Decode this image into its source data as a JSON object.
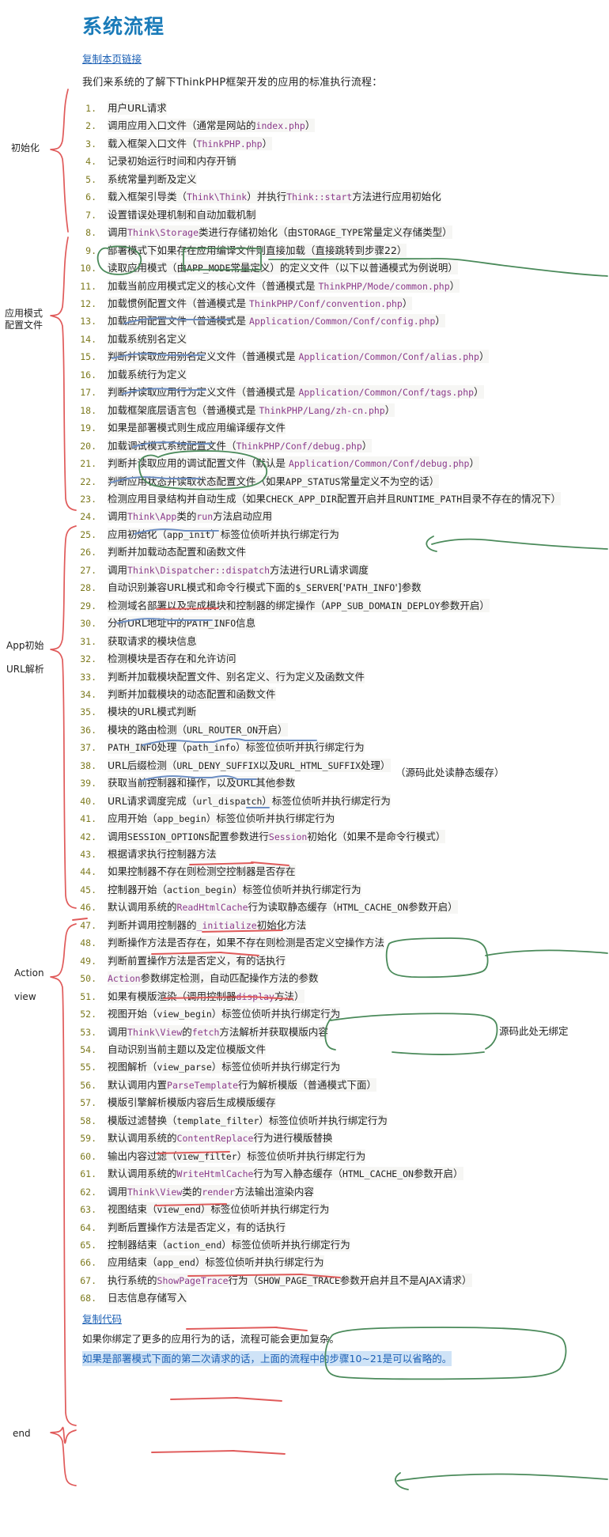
{
  "page": {
    "title": "系统流程",
    "copy_link_label": "复制本页链接",
    "intro": "我们来系统的了解下ThinkPHP框架开发的应用的标准执行流程：",
    "copy_code_label": "复制代码",
    "note": "如果你绑定了更多的应用行为的话，流程可能会更加复杂。",
    "note_highlight": "如果是部署模式下面的第二次请求的话，上面的流程中的步骤10~21是可以省略的。",
    "title_color": "#1a7bb9",
    "link_color": "#1a5fb4",
    "number_color": "#7d7a1e",
    "code_color": "#8b3a8b",
    "red_annotation_color": "#e05a5a",
    "green_annotation_color": "#4a8a5a",
    "blue_underline_color": "#6d8fc4"
  },
  "group_labels": [
    {
      "name": "init",
      "text": "初始化"
    },
    {
      "name": "app-mode-config",
      "text": "应用模式\n配置文件"
    },
    {
      "name": "app-init-url-parse",
      "text": "App初始\n\nURL解析"
    },
    {
      "name": "action-view",
      "text": "Action\n\nview"
    },
    {
      "name": "end",
      "text": "end"
    }
  ],
  "annotations": [
    {
      "name": "note-read-static-cache",
      "text": "（源码此处读静态缓存）"
    },
    {
      "name": "note-no-binding",
      "text": "源码此处无绑定"
    }
  ],
  "steps": [
    {
      "n": 1,
      "text": "用户URL请求"
    },
    {
      "n": 2,
      "text": "调用应用入口文件（通常是网站的index.php）"
    },
    {
      "n": 3,
      "text": "载入框架入口文件（ThinkPHP.php）"
    },
    {
      "n": 4,
      "text": "记录初始运行时间和内存开销"
    },
    {
      "n": 5,
      "text": "系统常量判断及定义"
    },
    {
      "n": 6,
      "text": "载入框架引导类（Think\\Think）并执行Think::start方法进行应用初始化"
    },
    {
      "n": 7,
      "text": "设置错误处理机制和自动加载机制"
    },
    {
      "n": 8,
      "text": "调用Think\\Storage类进行存储初始化（由STORAGE_TYPE常量定义存储类型）"
    },
    {
      "n": 9,
      "text": "部署模式下如果存在应用编译文件则直接加载（直接跳转到步骤22）"
    },
    {
      "n": 10,
      "text": "读取应用模式（由APP_MODE常量定义）的定义文件（以下以普通模式为例说明）"
    },
    {
      "n": 11,
      "text": "加载当前应用模式定义的核心文件（普通模式是 ThinkPHP/Mode/common.php）"
    },
    {
      "n": 12,
      "text": "加载惯例配置文件（普通模式是 ThinkPHP/Conf/convention.php）"
    },
    {
      "n": 13,
      "text": "加载应用配置文件（普通模式是 Application/Common/Conf/config.php）"
    },
    {
      "n": 14,
      "text": "加载系统别名定义"
    },
    {
      "n": 15,
      "text": "判断并读取应用别名定义文件（普通模式是 Application/Common/Conf/alias.php）"
    },
    {
      "n": 16,
      "text": "加载系统行为定义"
    },
    {
      "n": 17,
      "text": "判断并读取应用行为定义文件（普通模式是 Application/Common/Conf/tags.php）"
    },
    {
      "n": 18,
      "text": "加载框架底层语言包（普通模式是 ThinkPHP/Lang/zh-cn.php）"
    },
    {
      "n": 19,
      "text": "如果是部署模式则生成应用编译缓存文件"
    },
    {
      "n": 20,
      "text": "加载调试模式系统配置文件（ThinkPHP/Conf/debug.php）"
    },
    {
      "n": 21,
      "text": "判断并读取应用的调试配置文件（默认是 Application/Common/Conf/debug.php）"
    },
    {
      "n": 22,
      "text": "判断应用状态并读取状态配置文件（如果APP_STATUS常量定义不为空的话）"
    },
    {
      "n": 23,
      "text": "检测应用目录结构并自动生成（如果CHECK_APP_DIR配置开启并且RUNTIME_PATH目录不存在的情况下）"
    },
    {
      "n": 24,
      "text": "调用Think\\App类的run方法启动应用"
    },
    {
      "n": 25,
      "text": "应用初始化（app_init）标签位侦听并执行绑定行为"
    },
    {
      "n": 26,
      "text": "判断并加载动态配置和函数文件"
    },
    {
      "n": 27,
      "text": "调用Think\\Dispatcher::dispatch方法进行URL请求调度"
    },
    {
      "n": 28,
      "text": "自动识别兼容URL模式和命令行模式下面的$_SERVER['PATH_INFO']参数"
    },
    {
      "n": 29,
      "text": "检测域名部署以及完成模块和控制器的绑定操作（APP_SUB_DOMAIN_DEPLOY参数开启）"
    },
    {
      "n": 30,
      "text": "分析URL地址中的PATH_INFO信息"
    },
    {
      "n": 31,
      "text": "获取请求的模块信息"
    },
    {
      "n": 32,
      "text": "检测模块是否存在和允许访问"
    },
    {
      "n": 33,
      "text": "判断并加载模块配置文件、别名定义、行为定义及函数文件"
    },
    {
      "n": 34,
      "text": "判断并加载模块的动态配置和函数文件"
    },
    {
      "n": 35,
      "text": "模块的URL模式判断"
    },
    {
      "n": 36,
      "text": "模块的路由检测（URL_ROUTER_ON开启）"
    },
    {
      "n": 37,
      "text": "PATH_INFO处理（path_info）标签位侦听并执行绑定行为"
    },
    {
      "n": 38,
      "text": "URL后缀检测（URL_DENY_SUFFIX以及URL_HTML_SUFFIX处理）"
    },
    {
      "n": 39,
      "text": "获取当前控制器和操作，以及URL其他参数"
    },
    {
      "n": 40,
      "text": "URL请求调度完成（url_dispatch）标签位侦听并执行绑定行为"
    },
    {
      "n": 41,
      "text": "应用开始（app_begin）标签位侦听并执行绑定行为"
    },
    {
      "n": 42,
      "text": "调用SESSION_OPTIONS配置参数进行Session初始化（如果不是命令行模式）"
    },
    {
      "n": 43,
      "text": "根据请求执行控制器方法"
    },
    {
      "n": 44,
      "text": "如果控制器不存在则检测空控制器是否存在"
    },
    {
      "n": 45,
      "text": "控制器开始（action_begin）标签位侦听并执行绑定行为"
    },
    {
      "n": 46,
      "text": "默认调用系统的ReadHtmlCache行为读取静态缓存（HTML_CACHE_ON参数开启）"
    },
    {
      "n": 47,
      "text": "判断并调用控制器的_initialize初始化方法"
    },
    {
      "n": 48,
      "text": "判断操作方法是否存在，如果不存在则检测是否定义空操作方法"
    },
    {
      "n": 49,
      "text": "判断前置操作方法是否定义，有的话执行"
    },
    {
      "n": 50,
      "text": "Action参数绑定检测，自动匹配操作方法的参数"
    },
    {
      "n": 51,
      "text": "如果有模版渲染（调用控制器display方法）"
    },
    {
      "n": 52,
      "text": "视图开始（view_begin）标签位侦听并执行绑定行为"
    },
    {
      "n": 53,
      "text": "调用Think\\View的fetch方法解析并获取模版内容"
    },
    {
      "n": 54,
      "text": "自动识别当前主题以及定位模版文件"
    },
    {
      "n": 55,
      "text": "视图解析（view_parse）标签位侦听并执行绑定行为"
    },
    {
      "n": 56,
      "text": "默认调用内置ParseTemplate行为解析模版（普通模式下面）"
    },
    {
      "n": 57,
      "text": "模版引擎解析模版内容后生成模版缓存"
    },
    {
      "n": 58,
      "text": "模版过滤替换（template_filter）标签位侦听并执行绑定行为"
    },
    {
      "n": 59,
      "text": "默认调用系统的ContentReplace行为进行模版替换"
    },
    {
      "n": 60,
      "text": "输出内容过滤（view_filter）标签位侦听并执行绑定行为"
    },
    {
      "n": 61,
      "text": "默认调用系统的WriteHtmlCache行为写入静态缓存（HTML_CACHE_ON参数开启）"
    },
    {
      "n": 62,
      "text": "调用Think\\View类的render方法输出渲染内容"
    },
    {
      "n": 63,
      "text": "视图结束（view_end）标签位侦听并执行绑定行为"
    },
    {
      "n": 64,
      "text": "判断后置操作方法是否定义，有的话执行"
    },
    {
      "n": 65,
      "text": "控制器结束（action_end）标签位侦听并执行绑定行为"
    },
    {
      "n": 66,
      "text": "应用结束（app_end）标签位侦听并执行绑定行为"
    },
    {
      "n": 67,
      "text": "执行系统的ShowPageTrace行为（SHOW_PAGE_TRACE参数开启并且不是AJAX请求）"
    },
    {
      "n": 68,
      "text": "日志信息存储写入"
    }
  ]
}
